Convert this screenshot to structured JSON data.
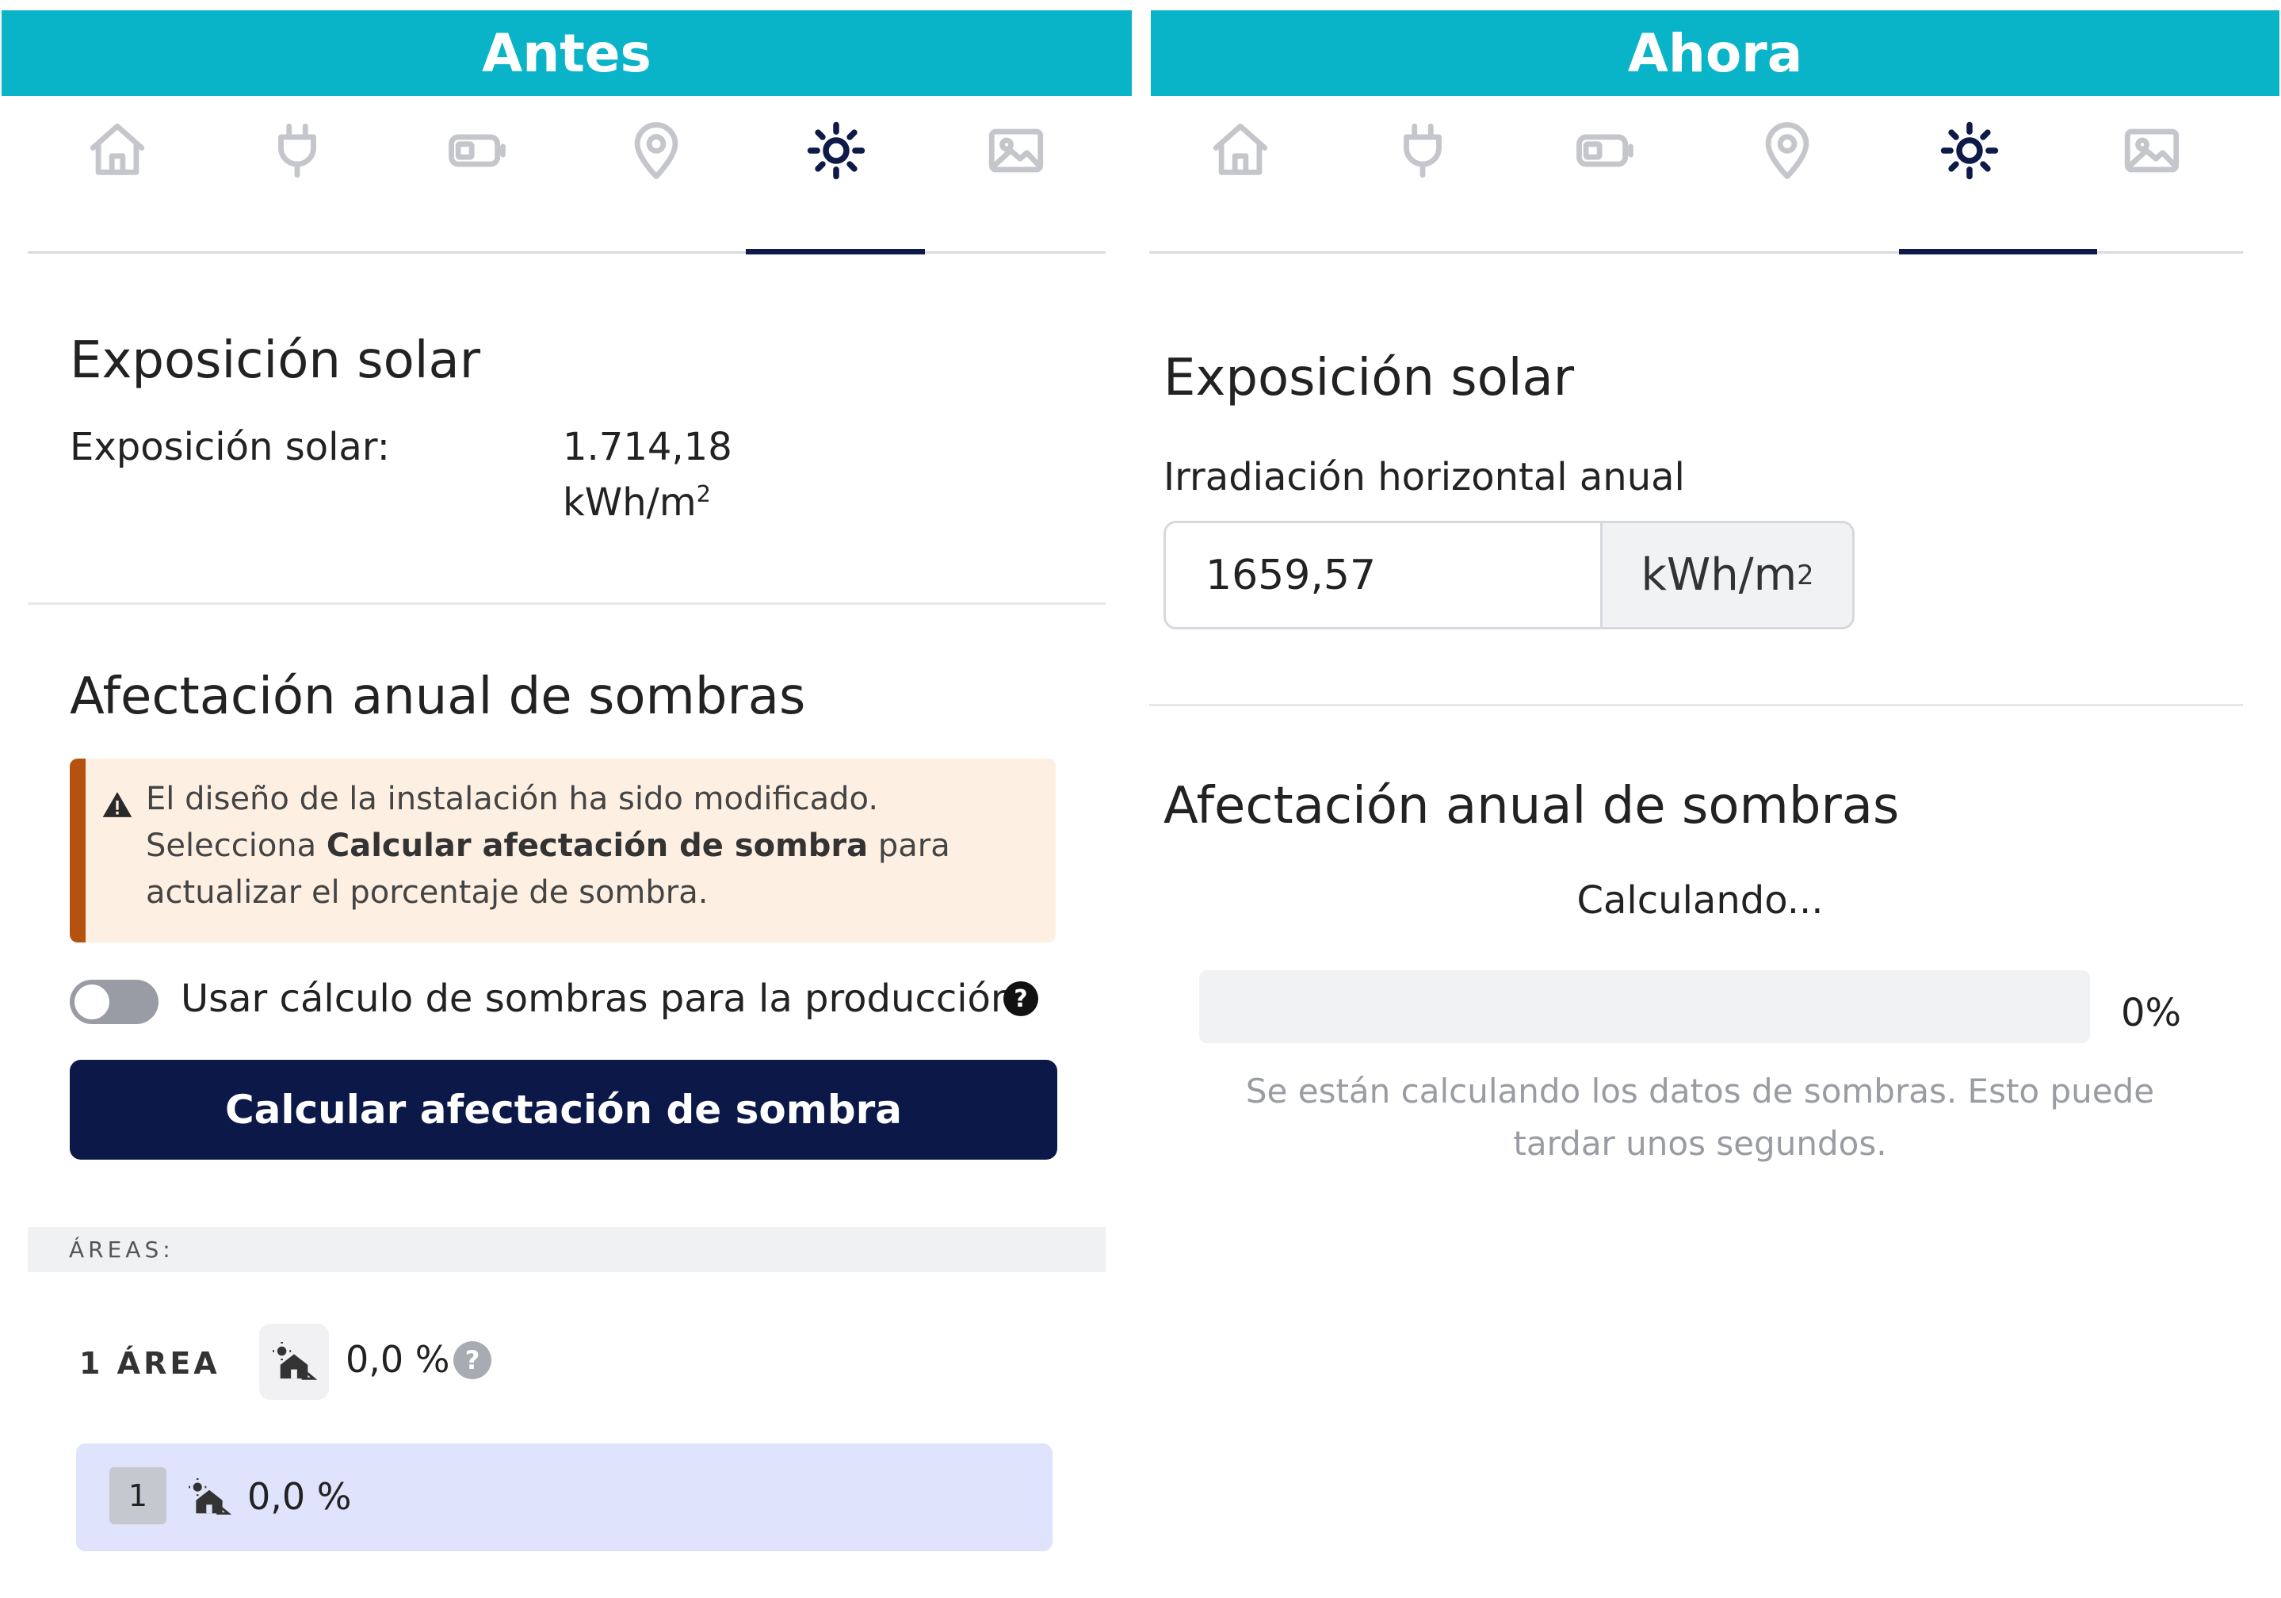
{
  "before": {
    "banner": "Antes",
    "tabs": [
      {
        "icon": "home-icon",
        "active": false
      },
      {
        "icon": "plug-icon",
        "active": false
      },
      {
        "icon": "battery-icon",
        "active": false
      },
      {
        "icon": "location-pin-icon",
        "active": false
      },
      {
        "icon": "sun-icon",
        "active": true
      },
      {
        "icon": "image-icon",
        "active": false
      }
    ],
    "solar": {
      "title": "Exposición solar",
      "label": "Exposición solar:",
      "value": "1.714,18",
      "unit_base": "kWh/m",
      "unit_exp": "2"
    },
    "shadows": {
      "title": "Afectación anual de sombras",
      "alert": {
        "line1": "El diseño de la instalación ha sido modificado. Selecciona",
        "bold": "Calcular afectación de sombra",
        "rest": " para actualizar el porcentaje de sombra."
      },
      "toggle_label": "Usar cálculo de sombras para la producción",
      "toggle_on": false,
      "help_symbol": "?",
      "button_label": "Calcular afectación de sombra"
    },
    "areas": {
      "header": "ÁREAS:",
      "count_label": "1 ÁREA",
      "total_shade": "0,0 %",
      "help_symbol": "?",
      "rows": [
        {
          "index": "1",
          "shade": "0,0 %"
        }
      ]
    }
  },
  "after": {
    "banner": "Ahora",
    "tabs": [
      {
        "icon": "home-icon",
        "active": false
      },
      {
        "icon": "plug-icon",
        "active": false
      },
      {
        "icon": "battery-icon",
        "active": false
      },
      {
        "icon": "location-pin-icon",
        "active": false
      },
      {
        "icon": "sun-icon",
        "active": true
      },
      {
        "icon": "image-icon",
        "active": false
      }
    ],
    "solar": {
      "title": "Exposición solar",
      "field_label": "Irradiación horizontal anual",
      "value": "1659,57",
      "unit_base": "kWh/m",
      "unit_exp": "2"
    },
    "shadows": {
      "title": "Afectación anual de sombras",
      "status": "Calculando...",
      "progress": 0,
      "progress_label": "0%",
      "hint": "Se están calculando los datos de sombras. Esto puede tardar unos segundos."
    }
  },
  "colors": {
    "banner": "#0ab4c8",
    "navy": "#0b1848",
    "alert_bg": "#fdf0e3",
    "alert_border": "#b5520f",
    "area_row_bg": "#dfe3fb"
  }
}
